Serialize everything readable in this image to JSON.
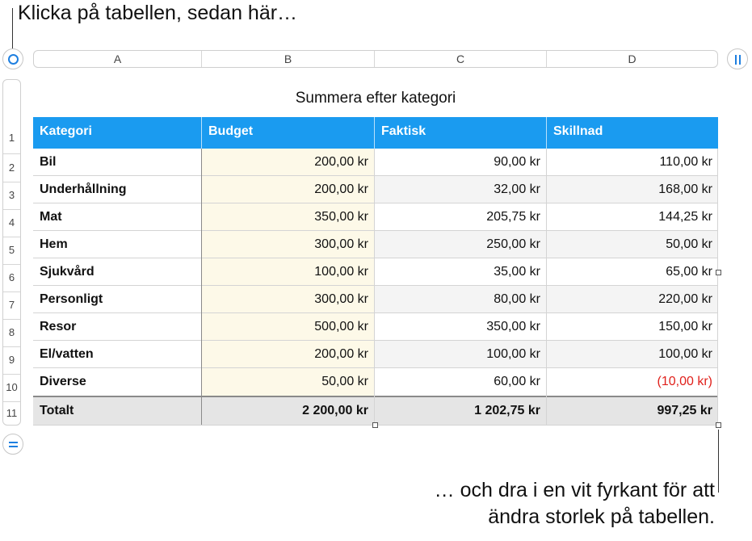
{
  "callouts": {
    "top": "Klicka på tabellen, sedan här…",
    "bottom_line1": "… och dra i en vit fyrkant för att",
    "bottom_line2": "ändra storlek på tabellen."
  },
  "column_letters": [
    "A",
    "B",
    "C",
    "D"
  ],
  "row_numbers": [
    "1",
    "2",
    "3",
    "4",
    "5",
    "6",
    "7",
    "8",
    "9",
    "10",
    "11"
  ],
  "table": {
    "title": "Summera efter kategori",
    "headers": [
      "Kategori",
      "Budget",
      "Faktisk",
      "Skillnad"
    ],
    "rows": [
      [
        "Bil",
        "200,00 kr",
        "90,00 kr",
        "110,00 kr"
      ],
      [
        "Underhållning",
        "200,00 kr",
        "32,00 kr",
        "168,00 kr"
      ],
      [
        "Mat",
        "350,00 kr",
        "205,75 kr",
        "144,25 kr"
      ],
      [
        "Hem",
        "300,00 kr",
        "250,00 kr",
        "50,00 kr"
      ],
      [
        "Sjukvård",
        "100,00 kr",
        "35,00 kr",
        "65,00 kr"
      ],
      [
        "Personligt",
        "300,00 kr",
        "80,00 kr",
        "220,00 kr"
      ],
      [
        "Resor",
        "500,00 kr",
        "350,00 kr",
        "150,00 kr"
      ],
      [
        "El/vatten",
        "200,00 kr",
        "100,00 kr",
        "100,00 kr"
      ],
      [
        "Diverse",
        "50,00 kr",
        "60,00 kr",
        "(10,00 kr)"
      ]
    ],
    "total": [
      "Totalt",
      "2 200,00 kr",
      "1 202,75 kr",
      "997,25 kr"
    ]
  },
  "colors": {
    "header_bg": "#1a9bf0",
    "negative_text": "#e0201b",
    "budget_column_bg": "#fdf9e8",
    "accent": "#1e7fe0"
  },
  "icons": {
    "select_table": "circle-select-icon",
    "column_control": "pause-icon",
    "row_control": "equals-icon"
  }
}
